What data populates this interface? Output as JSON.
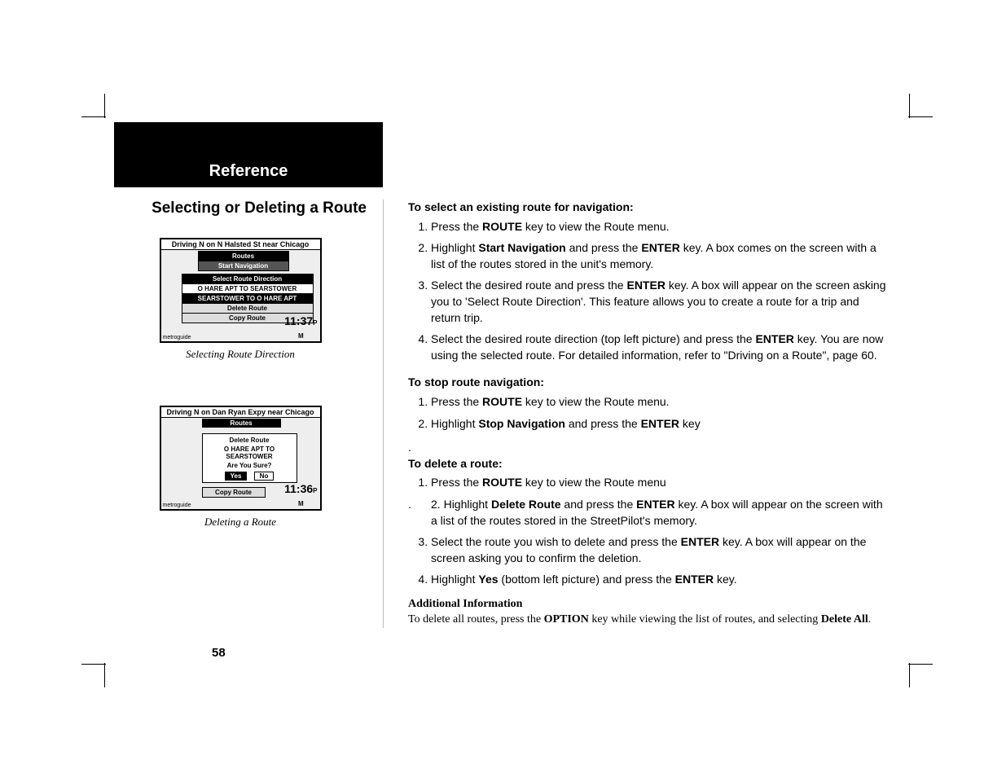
{
  "header": "Reference",
  "subtitle": "Selecting or Deleting a Route",
  "screenshot1": {
    "title": "Driving N on N Halsted St near Chicago",
    "menu_title": "Routes",
    "menu_item": "Start Navigation",
    "dialog_title": "Select Route Direction",
    "row1": "O HARE APT TO SEARSTOWER",
    "row2": "SEARSTOWER TO O HARE APT",
    "below1": "Delete Route",
    "below2": "Copy Route",
    "time": "11:37",
    "brand": "metroguide",
    "caption": "Selecting Route Direction"
  },
  "screenshot2": {
    "title": "Driving N on Dan Ryan Expy near Chicago",
    "menu_title": "Routes",
    "dlg_title": "Delete Route",
    "dlg_line1": "O HARE APT TO SEARSTOWER",
    "dlg_line2": "Are You Sure?",
    "btn_yes": "Yes",
    "btn_no": "No",
    "below": "Copy Route",
    "time": "11:36",
    "brand": "metroguide",
    "caption": "Deleting a Route"
  },
  "sect1": {
    "heading": "To select an existing route for navigation:",
    "steps": [
      {
        "pre": "Press the ",
        "b": "ROUTE",
        "post": " key to view the Route menu."
      },
      {
        "pre": "Highlight ",
        "b": "Start Navigation",
        "mid": " and press the ",
        "b2": "ENTER",
        "post": " key.  A box comes on the screen with a list of the routes stored in the unit's memory."
      },
      {
        "pre": "Select the desired route and press the ",
        "b": "ENTER",
        "post": " key.  A box will appear on the screen asking you to 'Select Route Direction'.  This feature allows you to create a route for a trip and return trip."
      },
      {
        "pre": "Select the desired route direction (top left picture) and press the ",
        "b": "ENTER",
        "post": " key. You are now using the selected route.  For detailed information, refer to \"Driving on a Route\", page 60."
      }
    ]
  },
  "sect2": {
    "heading": "To stop route navigation:",
    "steps": [
      {
        "pre": "Press the ",
        "b": "ROUTE",
        "post": " key to view the Route menu."
      },
      {
        "pre": "Highlight ",
        "b": "Stop Navigation",
        "mid": " and press the ",
        "b2": "ENTER",
        "post": " key"
      }
    ]
  },
  "stray_dot": ".",
  "sect3": {
    "heading": "To delete a route:",
    "steps": [
      {
        "pre": "Press the ",
        "b": "ROUTE",
        "post": " key to view the Route menu"
      },
      {
        "dotpre": ".   ",
        "pre": "Highlight ",
        "b": "Delete Route",
        "mid": " and press the ",
        "b2": "ENTER",
        "post": " key.  A box will appear on the screen with a list of the routes stored in the StreetPilot's memory."
      },
      {
        "pre": "Select the route you wish to delete and press the ",
        "b": "ENTER",
        "post": " key.  A box will appear on the screen asking you to confirm the deletion."
      },
      {
        "pre": "Highlight ",
        "b": "Yes",
        "mid": " (bottom left picture) and press the ",
        "b2": "ENTER",
        "post": " key."
      }
    ]
  },
  "additional": {
    "heading": "Additional Information",
    "pre": "To delete all routes, press the ",
    "b1": "OPTION",
    "mid": " key while viewing the list of routes, and selecting ",
    "b2": "Delete All",
    "post": "."
  },
  "page_number": "58"
}
